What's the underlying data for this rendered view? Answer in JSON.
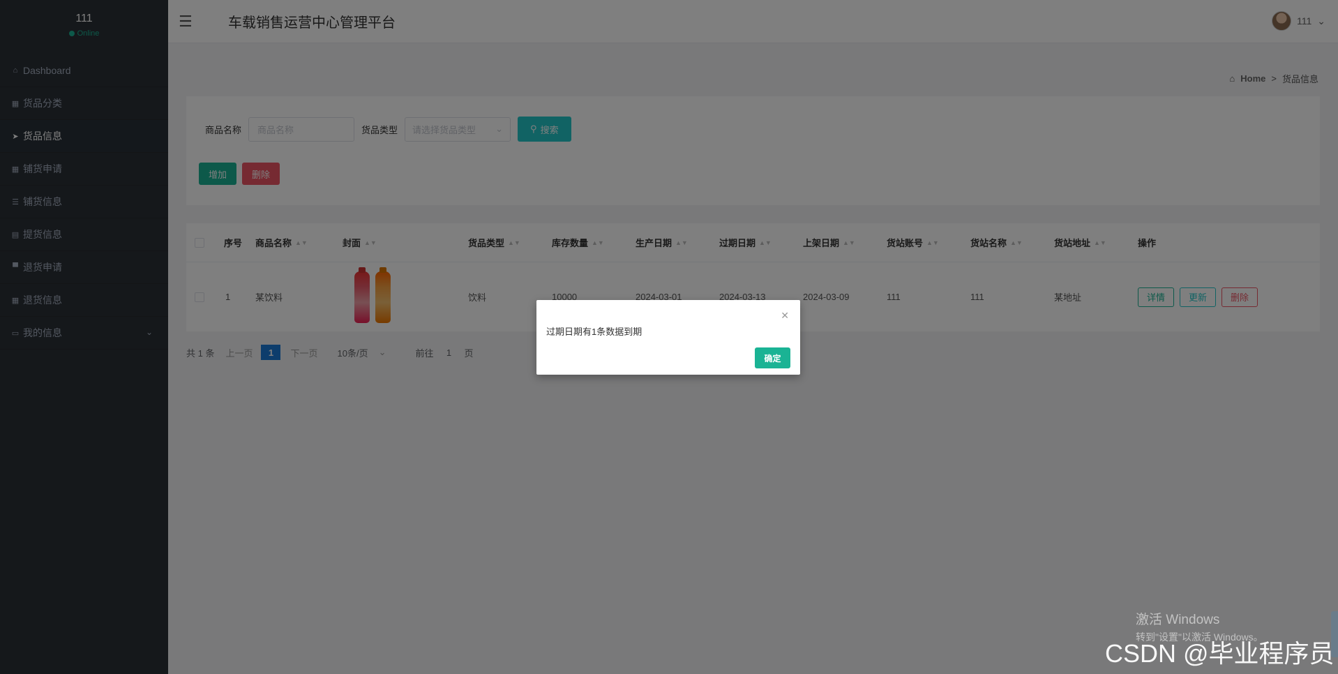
{
  "sidebar": {
    "user_name": "111",
    "user_status": "Online",
    "items": [
      {
        "label": "Dashboard",
        "icon": "home-icon"
      },
      {
        "label": "货品分类",
        "icon": "grid-icon"
      },
      {
        "label": "货品信息",
        "icon": "send-icon"
      },
      {
        "label": "铺货申请",
        "icon": "grid-icon"
      },
      {
        "label": "铺货信息",
        "icon": "list-icon"
      },
      {
        "label": "提货信息",
        "icon": "table-icon"
      },
      {
        "label": "退货申请",
        "icon": "file-icon"
      },
      {
        "label": "退货信息",
        "icon": "grid-icon"
      },
      {
        "label": "我的信息",
        "icon": "card-icon"
      }
    ]
  },
  "header": {
    "title": "车载销售运营中心管理平台",
    "user": "111"
  },
  "breadcrumb": {
    "home": "Home",
    "separator": ">",
    "current": "货品信息"
  },
  "search": {
    "name_label": "商品名称",
    "name_placeholder": "商品名称",
    "type_label": "货品类型",
    "type_placeholder": "请选择货品类型",
    "search_button": "搜索",
    "add_button": "增加",
    "delete_button": "删除"
  },
  "table": {
    "headers": [
      "序号",
      "商品名称",
      "封面",
      "货品类型",
      "库存数量",
      "生产日期",
      "过期日期",
      "上架日期",
      "货站账号",
      "货站名称",
      "货站地址",
      "操作"
    ],
    "rows": [
      {
        "index": "1",
        "name": "某饮料",
        "type": "饮料",
        "stock": "10000",
        "production_date": "2024-03-01",
        "expiry_date": "2024-03-13",
        "listing_date": "2024-03-09",
        "station_account": "111",
        "station_name": "111",
        "station_address": "某地址"
      }
    ],
    "actions": {
      "detail": "详情",
      "update": "更新",
      "delete": "删除"
    }
  },
  "pagination": {
    "total": "共 1 条",
    "prev": "上一页",
    "current": "1",
    "next": "下一页",
    "page_size": "10条/页",
    "goto_label": "前往",
    "goto_value": "1",
    "page_suffix": "页"
  },
  "modal": {
    "message": "过期日期有1条数据到期",
    "ok_button": "确定"
  },
  "watermarks": {
    "win_line1": "激活 Windows",
    "win_line2": "转到\"设置\"以激活 Windows。",
    "csdn": "CSDN @毕业程序员"
  },
  "colors": {
    "sidebar_bg": "#2b3036",
    "primary": "#1ab394",
    "info": "#23c6c8",
    "danger": "#ed5565",
    "page_active": "#1a7bd8"
  }
}
